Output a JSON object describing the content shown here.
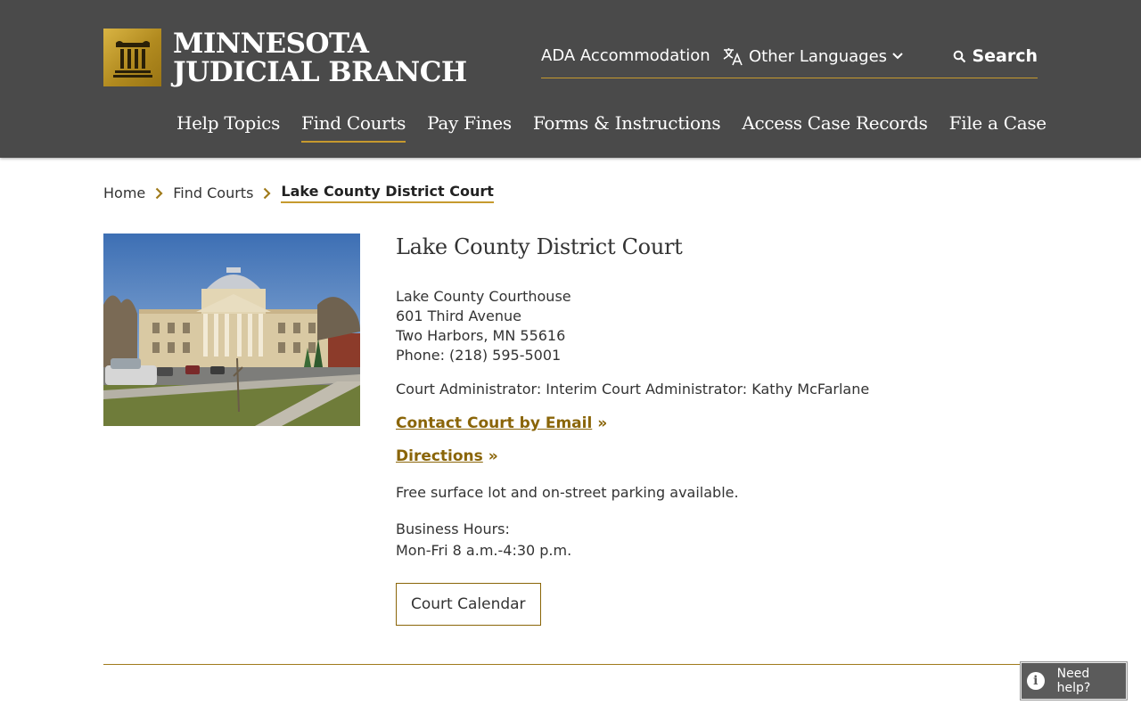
{
  "header": {
    "logo_line1": "MINNESOTA",
    "logo_line2": "JUDICIAL BRANCH",
    "utility": {
      "ada": "ADA Accommodation",
      "languages": "Other Languages",
      "search": "Search"
    },
    "nav": [
      {
        "label": "Help Topics"
      },
      {
        "label": "Find Courts",
        "active": true
      },
      {
        "label": "Pay Fines"
      },
      {
        "label": "Forms & Instructions"
      },
      {
        "label": "Access Case Records"
      },
      {
        "label": "File a Case"
      }
    ]
  },
  "breadcrumb": {
    "home": "Home",
    "parent": "Find Courts",
    "current": "Lake County District Court"
  },
  "court": {
    "title": "Lake County District Court",
    "address": [
      "Lake County Courthouse",
      "601 Third Avenue",
      "Two Harbors, MN 55616",
      "Phone: (218) 595-5001"
    ],
    "administrator": "Court Administrator: Interim Court Administrator: Kathy McFarlane",
    "email_link": "Contact Court by Email",
    "directions_link": "Directions",
    "link_suffix": "»",
    "parking": "Free surface lot and on-street parking available.",
    "hours_label": "Business Hours:",
    "hours": "Mon-Fri 8 a.m.-4:30 p.m.",
    "calendar_button": "Court Calendar"
  },
  "help_widget": {
    "label": "Need help?"
  },
  "colors": {
    "header_bg": "#4a4a4a",
    "accent_gold": "#c69a2e",
    "link_gold": "#8a6508"
  }
}
